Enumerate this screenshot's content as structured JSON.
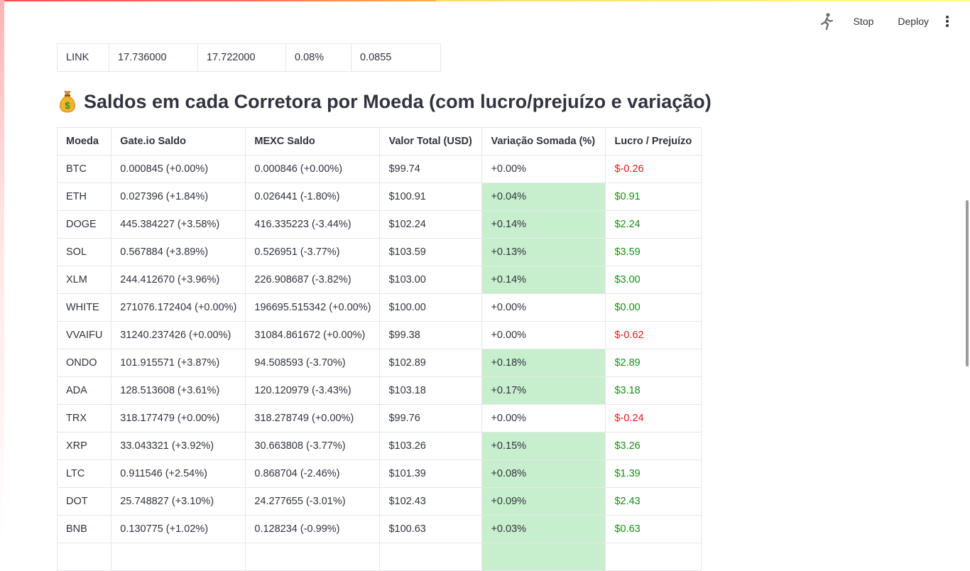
{
  "toolbar": {
    "stop_label": "Stop",
    "deploy_label": "Deploy"
  },
  "top_table": {
    "row": [
      "LINK",
      "17.736000",
      "17.722000",
      "0.08%",
      "0.0855"
    ]
  },
  "heading": {
    "text": "Saldos em cada Corretora por Moeda (com lucro/prejuízo e variação)"
  },
  "colors": {
    "green_highlight": "#c8efcd",
    "loss": "#e8141a",
    "profit": "#1a8c1a"
  },
  "balances_table": {
    "headers": [
      "Moeda",
      "Gate.io Saldo",
      "MEXC Saldo",
      "Valor Total (USD)",
      "Variação Somada (%)",
      "Lucro / Prejuízo"
    ],
    "rows": [
      {
        "moeda": "BTC",
        "gate": "0.000845 (+0.00%)",
        "mexc": "0.000846 (+0.00%)",
        "total": "$99.74",
        "var": "+0.00%",
        "pl": "$-0.26",
        "highlight": false,
        "loss": true
      },
      {
        "moeda": "ETH",
        "gate": "0.027396 (+1.84%)",
        "mexc": "0.026441 (-1.80%)",
        "total": "$100.91",
        "var": "+0.04%",
        "pl": "$0.91",
        "highlight": true,
        "loss": false
      },
      {
        "moeda": "DOGE",
        "gate": "445.384227 (+3.58%)",
        "mexc": "416.335223 (-3.44%)",
        "total": "$102.24",
        "var": "+0.14%",
        "pl": "$2.24",
        "highlight": true,
        "loss": false
      },
      {
        "moeda": "SOL",
        "gate": "0.567884 (+3.89%)",
        "mexc": "0.526951 (-3.77%)",
        "total": "$103.59",
        "var": "+0.13%",
        "pl": "$3.59",
        "highlight": true,
        "loss": false
      },
      {
        "moeda": "XLM",
        "gate": "244.412670 (+3.96%)",
        "mexc": "226.908687 (-3.82%)",
        "total": "$103.00",
        "var": "+0.14%",
        "pl": "$3.00",
        "highlight": true,
        "loss": false
      },
      {
        "moeda": "WHITE",
        "gate": "271076.172404 (+0.00%)",
        "mexc": "196695.515342 (+0.00%)",
        "total": "$100.00",
        "var": "+0.00%",
        "pl": "$0.00",
        "highlight": false,
        "loss": false
      },
      {
        "moeda": "VVAIFU",
        "gate": "31240.237426 (+0.00%)",
        "mexc": "31084.861672 (+0.00%)",
        "total": "$99.38",
        "var": "+0.00%",
        "pl": "$-0.62",
        "highlight": false,
        "loss": true
      },
      {
        "moeda": "ONDO",
        "gate": "101.915571 (+3.87%)",
        "mexc": "94.508593 (-3.70%)",
        "total": "$102.89",
        "var": "+0.18%",
        "pl": "$2.89",
        "highlight": true,
        "loss": false
      },
      {
        "moeda": "ADA",
        "gate": "128.513608 (+3.61%)",
        "mexc": "120.120979 (-3.43%)",
        "total": "$103.18",
        "var": "+0.17%",
        "pl": "$3.18",
        "highlight": true,
        "loss": false
      },
      {
        "moeda": "TRX",
        "gate": "318.177479 (+0.00%)",
        "mexc": "318.278749 (+0.00%)",
        "total": "$99.76",
        "var": "+0.00%",
        "pl": "$-0.24",
        "highlight": false,
        "loss": true
      },
      {
        "moeda": "XRP",
        "gate": "33.043321 (+3.92%)",
        "mexc": "30.663808 (-3.77%)",
        "total": "$103.26",
        "var": "+0.15%",
        "pl": "$3.26",
        "highlight": true,
        "loss": false
      },
      {
        "moeda": "LTC",
        "gate": "0.911546 (+2.54%)",
        "mexc": "0.868704 (-2.46%)",
        "total": "$101.39",
        "var": "+0.08%",
        "pl": "$1.39",
        "highlight": true,
        "loss": false
      },
      {
        "moeda": "DOT",
        "gate": "25.748827 (+3.10%)",
        "mexc": "24.277655 (-3.01%)",
        "total": "$102.43",
        "var": "+0.09%",
        "pl": "$2.43",
        "highlight": true,
        "loss": false
      },
      {
        "moeda": "BNB",
        "gate": "0.130775 (+1.02%)",
        "mexc": "0.128234 (-0.99%)",
        "total": "$100.63",
        "var": "+0.03%",
        "pl": "$0.63",
        "highlight": true,
        "loss": false
      },
      {
        "moeda": "",
        "gate": "",
        "mexc": "",
        "total": "",
        "var": "",
        "pl": "",
        "highlight": true,
        "loss": false
      }
    ]
  }
}
